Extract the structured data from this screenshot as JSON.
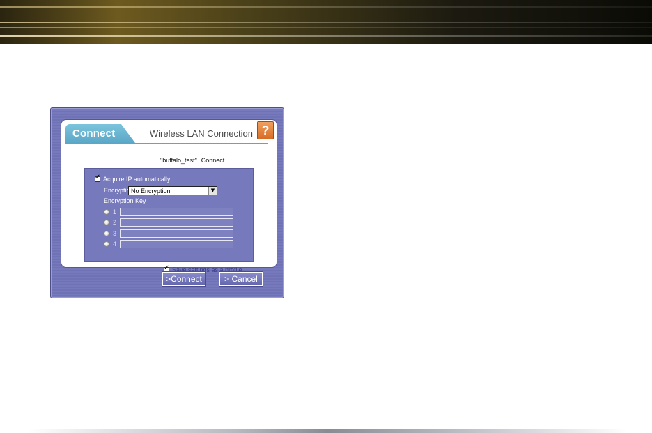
{
  "dialog": {
    "tab_label": "Connect",
    "title": "Wireless LAN Connection",
    "help_label": "?",
    "ssid": "\"buffalo_test\"",
    "ssid_action": "Connect",
    "acquire_ip": {
      "label": "Acquire IP automatically",
      "checked": true,
      "tick": "✓"
    },
    "encryption": {
      "label": "Encryption",
      "selected": "No Encryption",
      "arrow": "▼"
    },
    "encryption_key": {
      "label": "Encryption Key",
      "keys": [
        {
          "label": "1",
          "value": ""
        },
        {
          "label": "2",
          "value": ""
        },
        {
          "label": "3",
          "value": ""
        },
        {
          "label": "4",
          "value": ""
        }
      ]
    },
    "save_profile": {
      "label": "Save settings as a profile",
      "checked": true,
      "tick": "✓"
    },
    "buttons": {
      "connect": ">Connect",
      "cancel": "> Cancel"
    }
  },
  "colors": {
    "dialog_bg": "#7679bb",
    "header_accent": "#5aa7c7",
    "help_button": "#d86d25",
    "banner_dark": "#1c1a10"
  },
  "icons": {
    "help": "question-mark-icon",
    "dropdown": "chevron-down-icon",
    "checkbox_tick": "check-icon"
  }
}
